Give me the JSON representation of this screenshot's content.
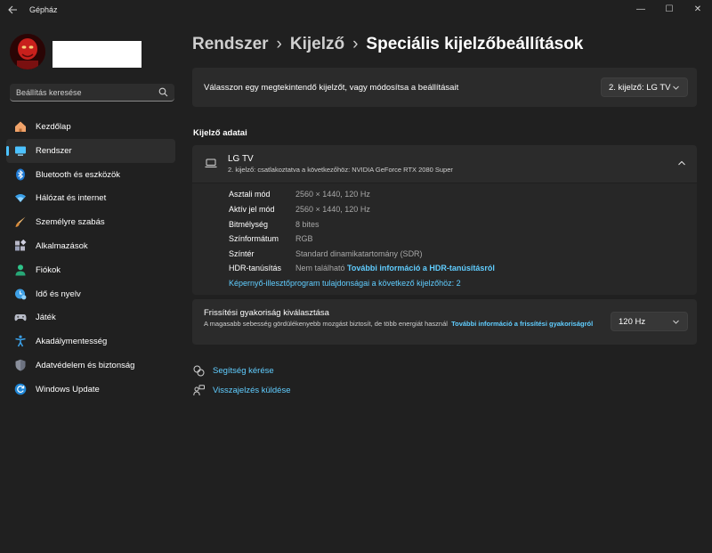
{
  "window": {
    "title": "Gépház",
    "controls": {
      "minimize": "—",
      "maximize": "☐",
      "close": "✕"
    }
  },
  "sidebar": {
    "search_placeholder": "Beállítás keresése",
    "items": [
      {
        "label": "Kezdőlap",
        "icon": "home-icon",
        "active": false
      },
      {
        "label": "Rendszer",
        "icon": "system-icon",
        "active": true
      },
      {
        "label": "Bluetooth és eszközök",
        "icon": "bluetooth-icon",
        "active": false
      },
      {
        "label": "Hálózat és internet",
        "icon": "wifi-icon",
        "active": false
      },
      {
        "label": "Személyre szabás",
        "icon": "brush-icon",
        "active": false
      },
      {
        "label": "Alkalmazások",
        "icon": "apps-icon",
        "active": false
      },
      {
        "label": "Fiókok",
        "icon": "person-icon",
        "active": false
      },
      {
        "label": "Idő és nyelv",
        "icon": "clock-globe-icon",
        "active": false
      },
      {
        "label": "Játék",
        "icon": "gamepad-icon",
        "active": false
      },
      {
        "label": "Akadálymentesség",
        "icon": "accessibility-icon",
        "active": false
      },
      {
        "label": "Adatvédelem és biztonság",
        "icon": "shield-icon",
        "active": false
      },
      {
        "label": "Windows Update",
        "icon": "update-icon",
        "active": false
      }
    ]
  },
  "breadcrumb": {
    "items": [
      "Rendszer",
      "Kijelző"
    ],
    "current": "Speciális kijelzőbeállítások",
    "separator": "›"
  },
  "monitor_select": {
    "label": "Válasszon egy megtekintendő kijelzőt, vagy módosítsa a beállításait",
    "value": "2. kijelző: LG TV"
  },
  "display_info": {
    "section_title": "Kijelző adatai",
    "name": "LG TV",
    "subtitle": "2. kijelző: csatlakoztatva a következőhöz: NVIDIA GeForce RTX 2080 Super",
    "rows": [
      {
        "key": "Asztali mód",
        "value": "2560 × 1440, 120 Hz"
      },
      {
        "key": "Aktív jel mód",
        "value": "2560 × 1440, 120 Hz"
      },
      {
        "key": "Bitmélység",
        "value": "8 bites"
      },
      {
        "key": "Színformátum",
        "value": "RGB"
      },
      {
        "key": "Színtér",
        "value": "Standard dinamikatartomány (SDR)"
      },
      {
        "key": "HDR-tanúsítás",
        "value": "Nem található",
        "link": "További információ a HDR-tanúsításról"
      }
    ],
    "adapter_link": "Képernyő-illesztőprogram tulajdonságai a következő kijelzőhöz: 2"
  },
  "refresh_rate": {
    "title": "Frissítési gyakoriság kiválasztása",
    "description": "A magasabb sebesség gördülékenyebb mozgást biztosít, de több energiát használ",
    "link": "További információ a frissítési gyakoriságról",
    "value": "120 Hz"
  },
  "help": {
    "get_help": "Segítség kérése",
    "feedback": "Visszajelzés küldése"
  },
  "colors": {
    "accent": "#60cdff",
    "background": "#202020",
    "card": "#2b2b2b"
  }
}
